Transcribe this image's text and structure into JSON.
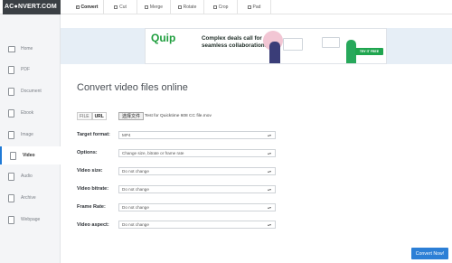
{
  "app": {
    "logo": "AC●NVERT.COM"
  },
  "tabs": [
    {
      "label": "Convert",
      "active": true
    },
    {
      "label": "Cut",
      "active": false
    },
    {
      "label": "Merge",
      "active": false
    },
    {
      "label": "Rotate",
      "active": false
    },
    {
      "label": "Crop",
      "active": false
    },
    {
      "label": "Pad",
      "active": false
    }
  ],
  "sidebar": {
    "items": [
      {
        "label": "Home",
        "icon": "home-icon"
      },
      {
        "label": "PDF",
        "icon": "pdf-icon"
      },
      {
        "label": "Document",
        "icon": "document-icon"
      },
      {
        "label": "Ebook",
        "icon": "ebook-icon"
      },
      {
        "label": "Image",
        "icon": "image-icon"
      },
      {
        "label": "Video",
        "icon": "video-icon",
        "active": true
      },
      {
        "label": "Audio",
        "icon": "audio-icon"
      },
      {
        "label": "Archive",
        "icon": "archive-icon"
      },
      {
        "label": "Webpage",
        "icon": "webpage-icon"
      }
    ]
  },
  "ad": {
    "brand": "Quip",
    "headline": "Complex deals call for seamless collaboration.",
    "cta": "TRY IT FREE"
  },
  "main": {
    "heading": "Convert video files online",
    "mode": {
      "file": "FILE",
      "url": "URL"
    },
    "file_button": "选择文件",
    "file_name": "Test for Quicktime 608 CC file.mov"
  },
  "options": [
    {
      "label": "Target format:",
      "value": "MP4"
    },
    {
      "label": "Options:",
      "value": "Change size, bitrate or frame rate"
    },
    {
      "label": "Video size:",
      "value": "Do not change"
    },
    {
      "label": "Video bitrate:",
      "value": "Do not change"
    },
    {
      "label": "Frame Rate:",
      "value": "Do not change"
    },
    {
      "label": "Video aspect:",
      "value": "Do not change"
    }
  ],
  "actions": {
    "convert": "Convert Now!"
  },
  "colors": {
    "accent": "#2c7fd6",
    "ad_green": "#1e9e3d",
    "logo_bg": "#3a3f44"
  }
}
